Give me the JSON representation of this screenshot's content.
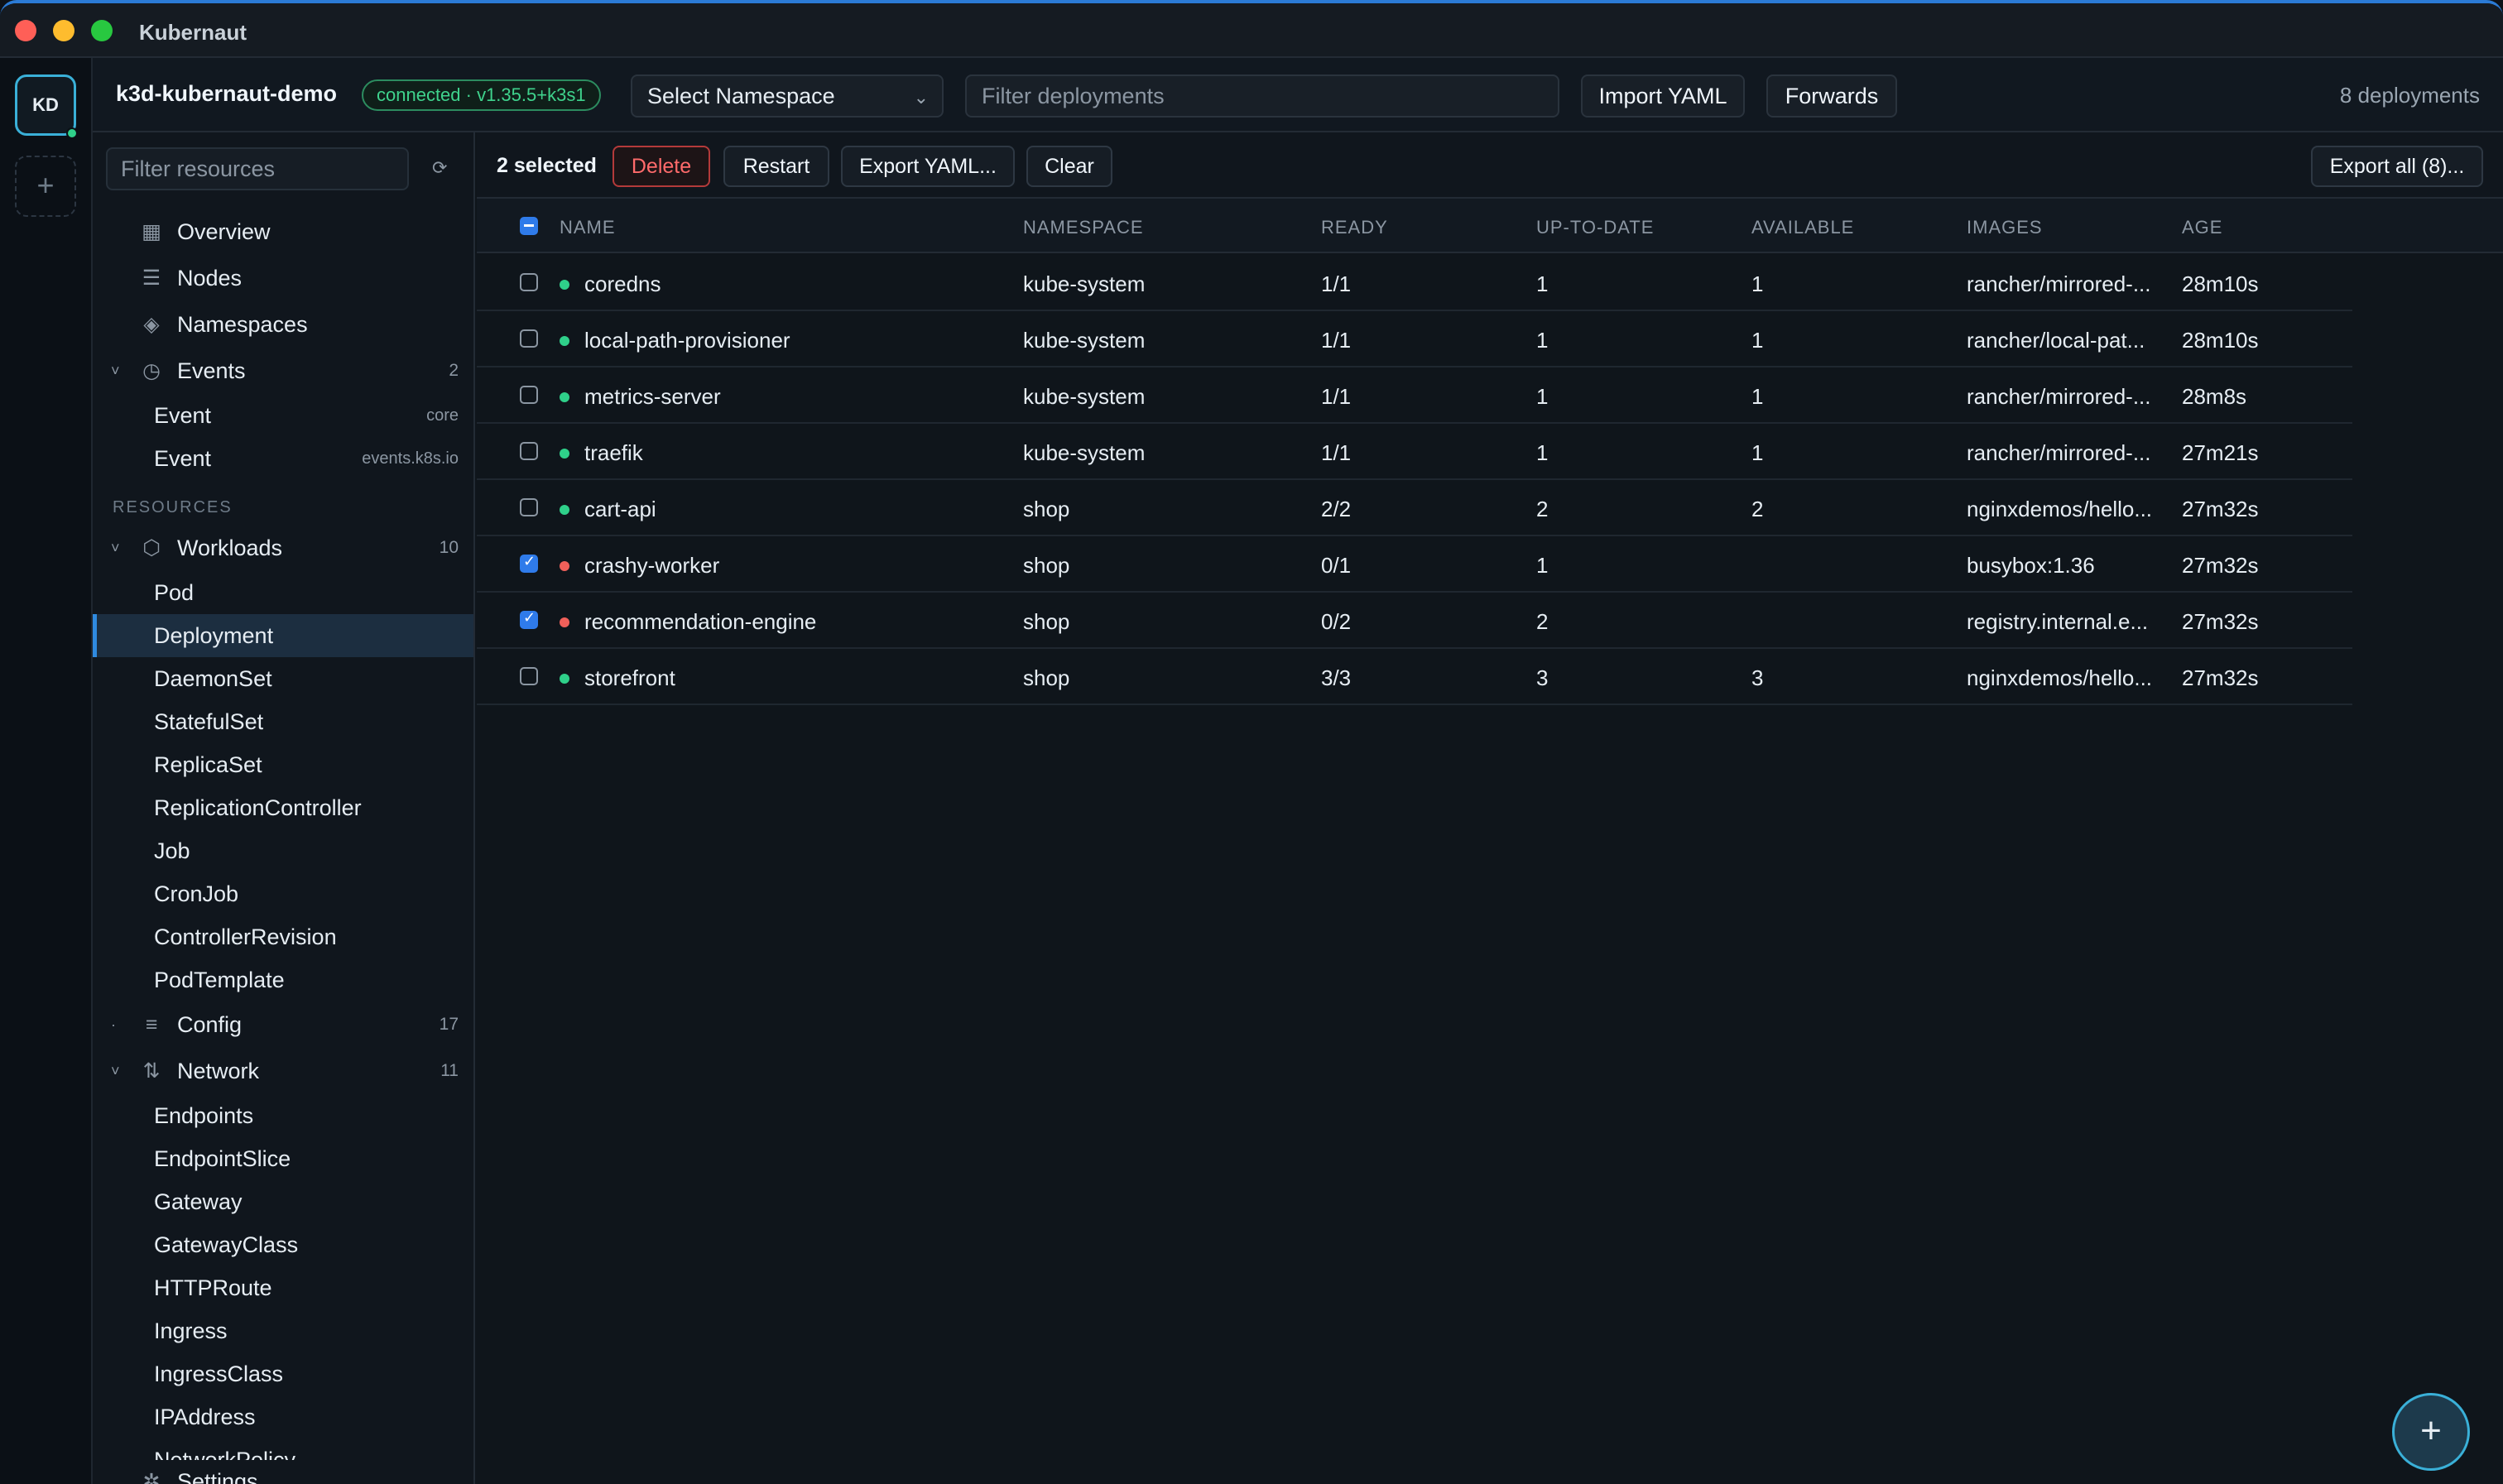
{
  "window": {
    "title": "Kubernaut"
  },
  "rail": {
    "cluster_initials": "KD",
    "add_label": "+"
  },
  "header": {
    "context": "k3d-kubernaut-demo",
    "status": "connected · v1.35.5+k3s1",
    "namespace_select": "Select Namespace",
    "filter_placeholder": "Filter deployments",
    "import_label": "Import YAML",
    "forwards_label": "Forwards",
    "count": "8 deployments"
  },
  "sidebar": {
    "filter_placeholder": "Filter resources",
    "overview": "Overview",
    "nodes": "Nodes",
    "namespaces": "Namespaces",
    "events": {
      "label": "Events",
      "count": "2",
      "items": [
        {
          "label": "Event",
          "group": "core"
        },
        {
          "label": "Event",
          "group": "events.k8s.io"
        }
      ]
    },
    "resources_header": "RESOURCES",
    "workloads": {
      "label": "Workloads",
      "count": "10",
      "items": [
        "Pod",
        "Deployment",
        "DaemonSet",
        "StatefulSet",
        "ReplicaSet",
        "ReplicationController",
        "Job",
        "CronJob",
        "ControllerRevision",
        "PodTemplate"
      ]
    },
    "config": {
      "label": "Config",
      "count": "17"
    },
    "network": {
      "label": "Network",
      "count": "11",
      "items": [
        "Endpoints",
        "EndpointSlice",
        "Gateway",
        "GatewayClass",
        "HTTPRoute",
        "Ingress",
        "IngressClass",
        "IPAddress",
        "NetworkPolicy"
      ]
    },
    "settings": "Settings",
    "active_item": "Deployment"
  },
  "toolbar": {
    "selected": "2 selected",
    "delete": "Delete",
    "restart": "Restart",
    "export": "Export YAML...",
    "clear": "Clear",
    "export_all": "Export all (8)..."
  },
  "table": {
    "columns": [
      "NAME",
      "NAMESPACE",
      "READY",
      "UP-TO-DATE",
      "AVAILABLE",
      "IMAGES",
      "AGE"
    ],
    "rows": [
      {
        "name": "coredns",
        "namespace": "kube-system",
        "ready": "1/1",
        "uptodate": "1",
        "available": "1",
        "images": "rancher/mirrored-...",
        "age": "28m10s",
        "healthy": true,
        "checked": false
      },
      {
        "name": "local-path-provisioner",
        "namespace": "kube-system",
        "ready": "1/1",
        "uptodate": "1",
        "available": "1",
        "images": "rancher/local-pat...",
        "age": "28m10s",
        "healthy": true,
        "checked": false
      },
      {
        "name": "metrics-server",
        "namespace": "kube-system",
        "ready": "1/1",
        "uptodate": "1",
        "available": "1",
        "images": "rancher/mirrored-...",
        "age": "28m8s",
        "healthy": true,
        "checked": false
      },
      {
        "name": "traefik",
        "namespace": "kube-system",
        "ready": "1/1",
        "uptodate": "1",
        "available": "1",
        "images": "rancher/mirrored-...",
        "age": "27m21s",
        "healthy": true,
        "checked": false
      },
      {
        "name": "cart-api",
        "namespace": "shop",
        "ready": "2/2",
        "uptodate": "2",
        "available": "2",
        "images": "nginxdemos/hello...",
        "age": "27m32s",
        "healthy": true,
        "checked": false
      },
      {
        "name": "crashy-worker",
        "namespace": "shop",
        "ready": "0/1",
        "uptodate": "1",
        "available": "",
        "images": "busybox:1.36",
        "age": "27m32s",
        "healthy": false,
        "checked": true
      },
      {
        "name": "recommendation-engine",
        "namespace": "shop",
        "ready": "0/2",
        "uptodate": "2",
        "available": "",
        "images": "registry.internal.e...",
        "age": "27m32s",
        "healthy": false,
        "checked": true
      },
      {
        "name": "storefront",
        "namespace": "shop",
        "ready": "3/3",
        "uptodate": "3",
        "available": "3",
        "images": "nginxdemos/hello...",
        "age": "27m32s",
        "healthy": true,
        "checked": false
      }
    ]
  },
  "colors": {
    "healthy": "#2fd08a",
    "unhealthy": "#f0605a",
    "accent": "#2f7bea"
  },
  "fab": {
    "label": "+"
  }
}
